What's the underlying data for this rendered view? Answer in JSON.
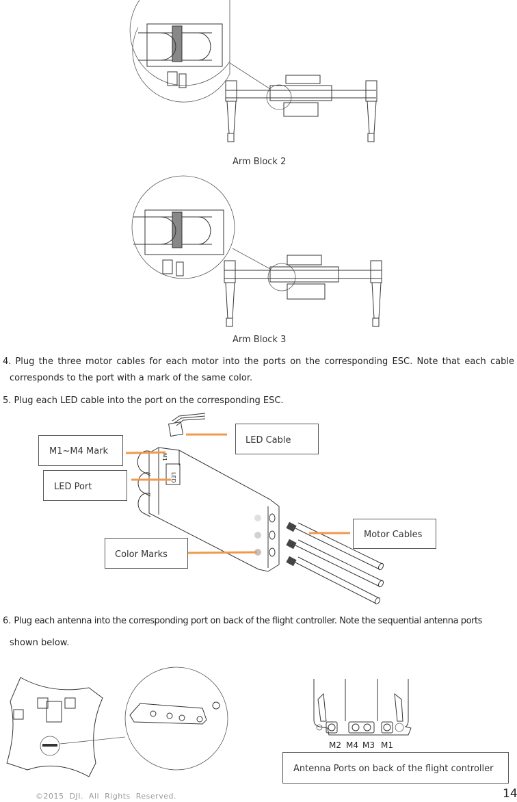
{
  "figures": {
    "arm_block_2": {
      "caption": "Arm Block 2"
    },
    "arm_block_3": {
      "caption": "Arm Block 3"
    }
  },
  "steps": [
    {
      "number": "4.",
      "text_line1": "Plug the three motor cables for each motor into the ports on the corresponding ESC. Note that each cable",
      "text_line2": "corresponds to the port with a mark of the same color."
    },
    {
      "number": "5.",
      "text_line1": "Plug each LED cable into the port on the corresponding ESC."
    },
    {
      "number": "6.",
      "text_line1": "Plug each antenna into the corresponding port on back of the flight controller. Note the sequential antenna ports",
      "text_line2": "shown below."
    }
  ],
  "esc_diagram": {
    "callouts": {
      "m1_m4_mark": "M1~M4 Mark",
      "led_port": "LED Port",
      "led_cable": "LED Cable",
      "color_marks": "Color Marks",
      "motor_cables": "Motor Cables"
    },
    "esc_labels": {
      "m_mark": "M1",
      "led": "LED"
    },
    "callout_line_color": "#f0994a"
  },
  "antenna_diagram": {
    "port_labels": [
      "M2",
      "M4",
      "M3",
      "M1"
    ],
    "callout": "Antenna Ports on back of the flight controller"
  },
  "footer": {
    "copyright": "©2015  DJI.  All  Rights  Reserved.",
    "page_number": "14"
  }
}
